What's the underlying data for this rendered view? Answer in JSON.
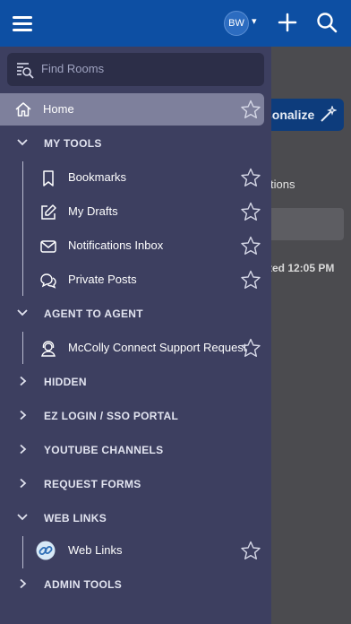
{
  "topbar": {
    "avatar_initials": "BW",
    "caret": "▾",
    "colors": {
      "bar": "#0d4fa3"
    }
  },
  "background_page": {
    "personalize_label": "sonalize",
    "tab_partial": "tions",
    "updated_partial": "ted 12:05 PM"
  },
  "drawer": {
    "search_placeholder": "Find Rooms",
    "home_label": "Home",
    "sections": {
      "my_tools": "MY TOOLS",
      "agent_to_agent": "AGENT TO AGENT",
      "hidden": "HIDDEN",
      "ez_login": "EZ LOGIN / SSO PORTAL",
      "youtube": "YOUTUBE CHANNELS",
      "request_forms": "REQUEST FORMS",
      "web_links": "WEB LINKS",
      "admin_tools": "ADMIN TOOLS"
    },
    "items": {
      "bookmarks": "Bookmarks",
      "my_drafts": "My Drafts",
      "notifications_inbox": "Notifications Inbox",
      "private_posts": "Private Posts",
      "mccolly_support": "McColly Connect Support Request",
      "web_links": "Web Links"
    }
  }
}
